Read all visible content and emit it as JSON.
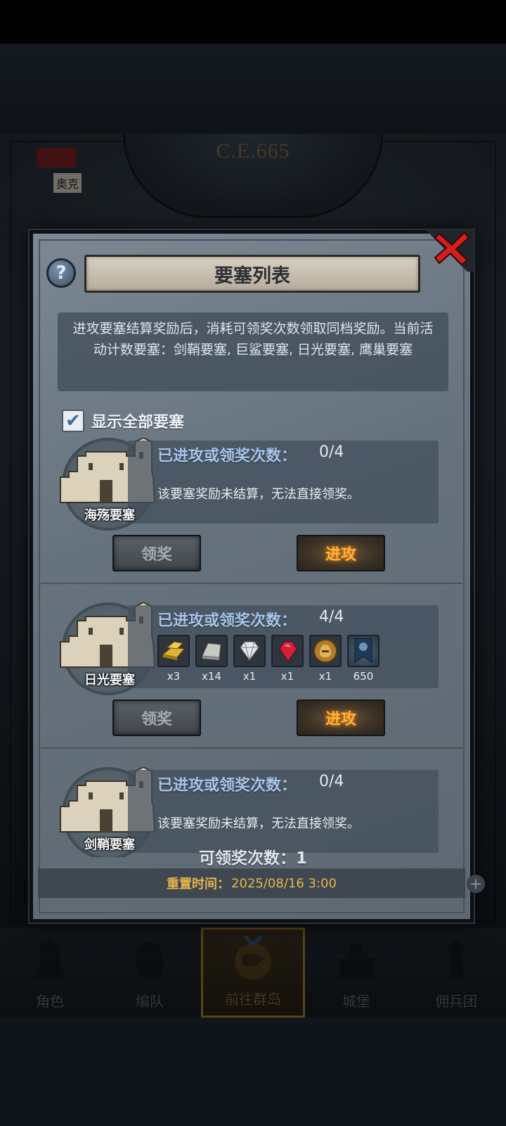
{
  "background": {
    "year_display": "C.E.665",
    "map_label": "奥克"
  },
  "modal": {
    "title": "要塞列表",
    "help_icon": "question-mark-icon",
    "close_icon": "red-x-icon",
    "info_text": "进攻要塞结算奖励后，消耗可领奖次数领取同档奖励。当前活动计数要塞：剑鞘要塞, 巨鲨要塞, 日光要塞, 鹰巢要塞",
    "show_all": {
      "checked": true,
      "label": "显示全部要塞"
    },
    "forts": [
      {
        "name": "海殇要塞",
        "stats_label": "已进攻或领奖次数：",
        "count": "0/4",
        "message": "该要塞奖励未结算，无法直接领奖。",
        "claim_label": "领奖",
        "attack_label": "进攻"
      },
      {
        "name": "日光要塞",
        "stats_label": "已进攻或领奖次数：",
        "count": "4/4",
        "rewards": [
          {
            "icon": "gold-bar-icon",
            "qty": "x3"
          },
          {
            "icon": "silver-bar-icon",
            "qty": "x14"
          },
          {
            "icon": "diamond-icon",
            "qty": "x1"
          },
          {
            "icon": "ruby-icon",
            "qty": "x1"
          },
          {
            "icon": "helmet-medal-icon",
            "qty": "x1"
          },
          {
            "icon": "banner-icon",
            "qty": "650"
          }
        ],
        "claim_label": "领奖",
        "attack_label": "进攻"
      },
      {
        "name": "剑鞘要塞",
        "stats_label": "已进攻或领奖次数：",
        "count": "0/4",
        "message": "该要塞奖励未结算，无法直接领奖。"
      }
    ],
    "claims_left": "可领奖次数：1",
    "reset_label": "重置时间：",
    "reset_value": "2025/08/16 3:00"
  },
  "bottom_nav": [
    {
      "label": "角色",
      "icon": "knight-icon"
    },
    {
      "label": "编队",
      "icon": "helmet-icon"
    },
    {
      "label": "前往群岛",
      "icon": "globe-icon",
      "active": true
    },
    {
      "label": "城堡",
      "icon": "castle-icon"
    },
    {
      "label": "佣兵团",
      "icon": "tower-icon"
    }
  ],
  "colors": {
    "accent_gold": "#e6b54a",
    "attack_text": "#ffb23c",
    "stats_blue": "#a7c6ec",
    "close_red": "#d21f1f"
  }
}
